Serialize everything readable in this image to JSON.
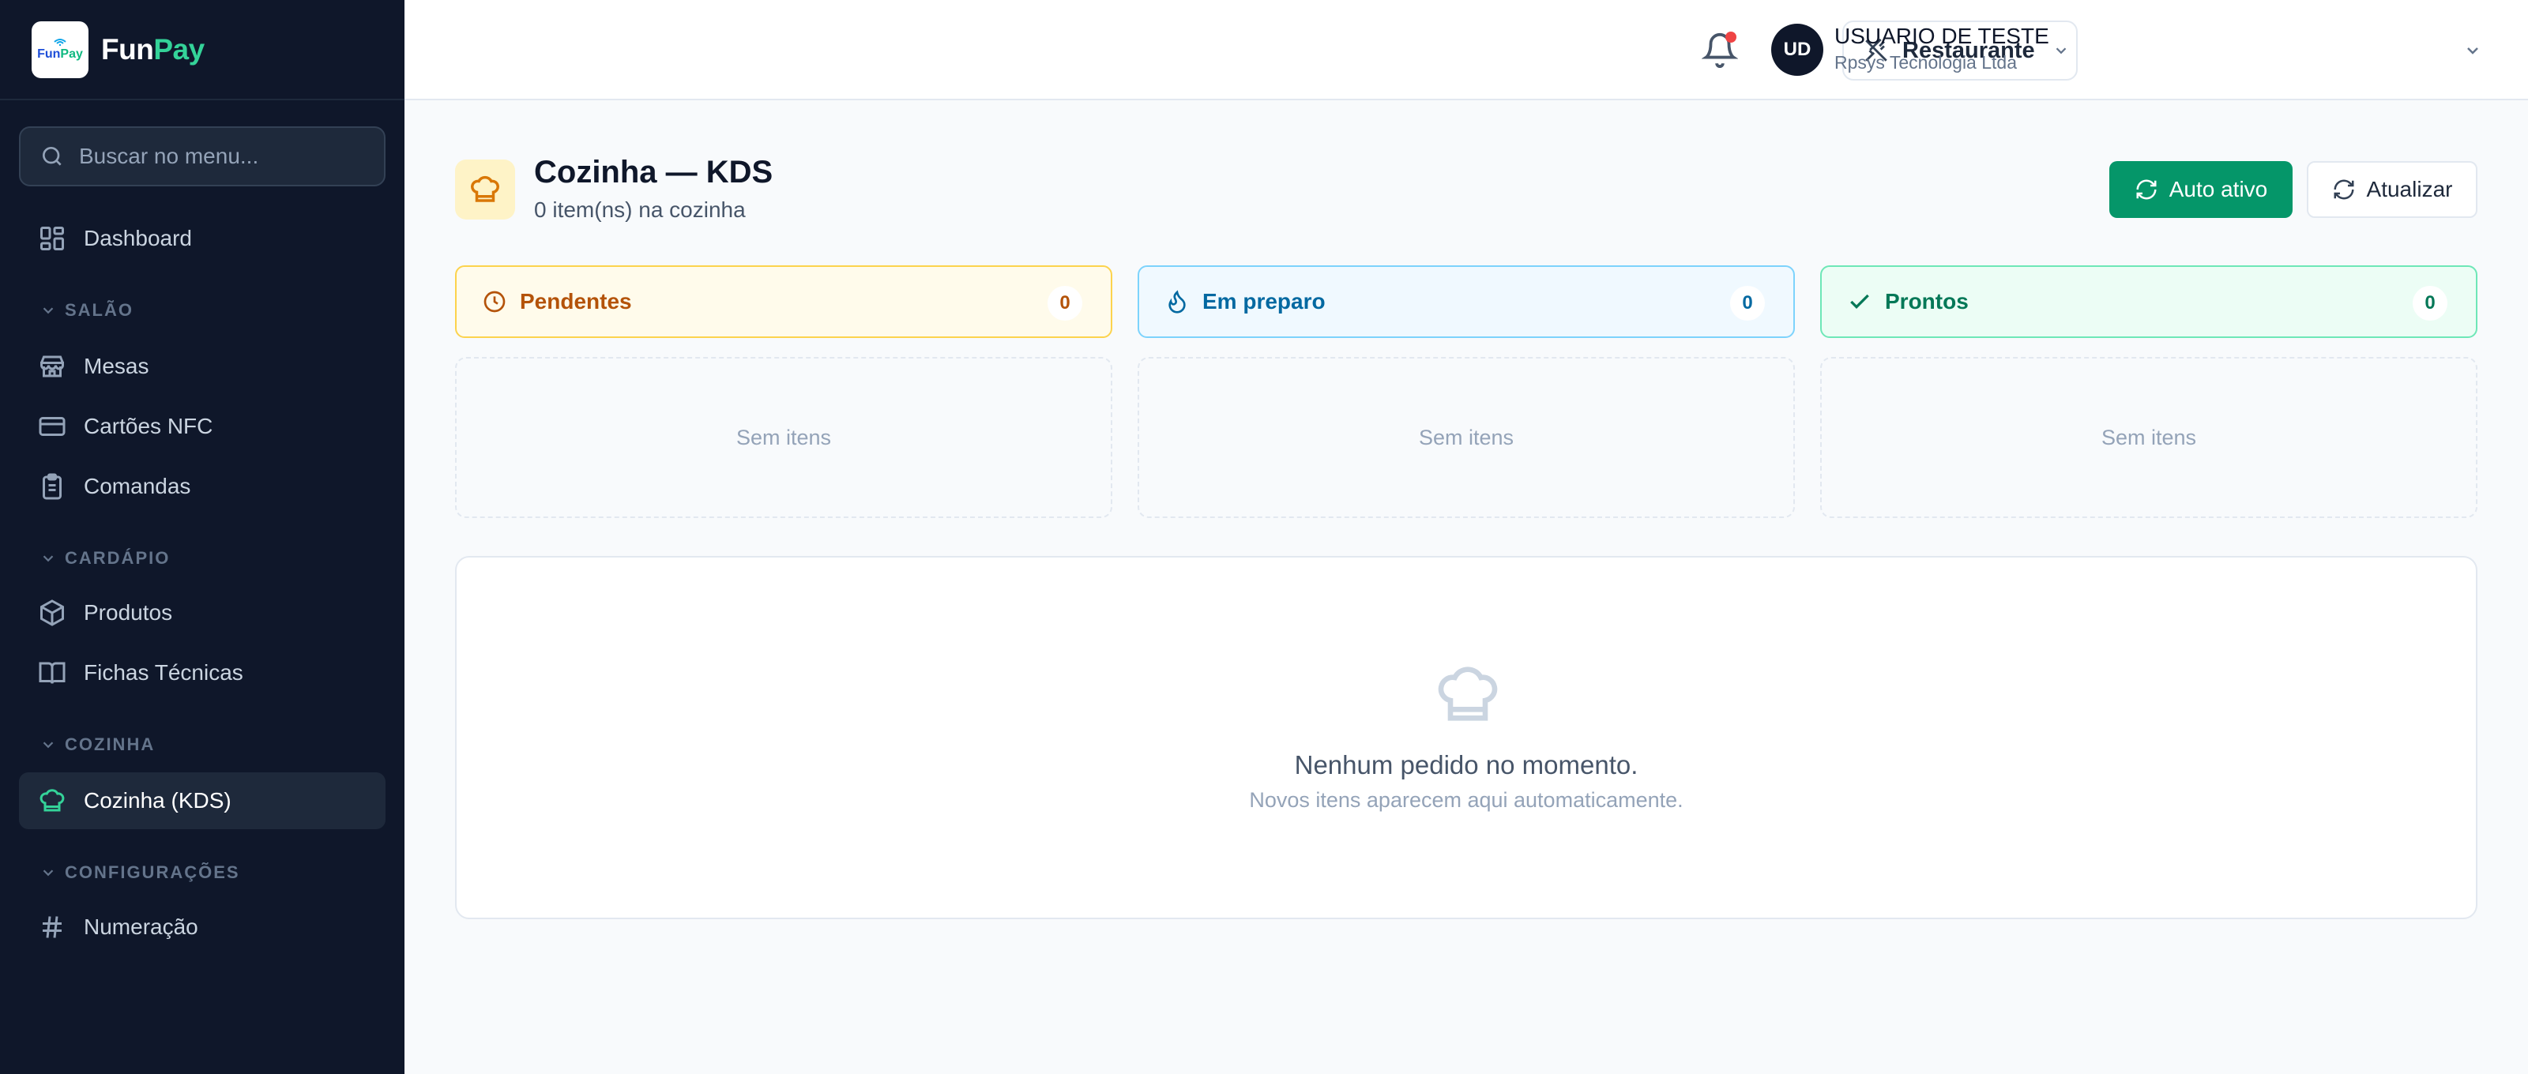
{
  "brand": {
    "logo_text_a": "Fun",
    "logo_text_b": "Pay",
    "name_a": "Fun",
    "name_b": "Pay"
  },
  "sidebar": {
    "search_placeholder": "Buscar no menu...",
    "dashboard": "Dashboard",
    "sections": {
      "salao": "SALÃO",
      "cardapio": "CARDÁPIO",
      "cozinha": "COZINHA",
      "config": "CONFIGURAÇÕES"
    },
    "items": {
      "mesas": "Mesas",
      "cartoes": "Cartões NFC",
      "comandas": "Comandas",
      "produtos": "Produtos",
      "fichas": "Fichas Técnicas",
      "kds": "Cozinha (KDS)",
      "numeracao": "Numeração"
    }
  },
  "header": {
    "store": "Restaurante",
    "user_initials": "UD",
    "user_name": "USUARIO DE TESTE",
    "user_company": "Rpsys Tecnologia Ltda"
  },
  "page": {
    "title": "Cozinha — KDS",
    "subtitle": "0 item(ns) na cozinha",
    "auto_label": "Auto ativo",
    "refresh_label": "Atualizar"
  },
  "columns": [
    {
      "label": "Pendentes",
      "count": "0",
      "empty": "Sem itens"
    },
    {
      "label": "Em preparo",
      "count": "0",
      "empty": "Sem itens"
    },
    {
      "label": "Prontos",
      "count": "0",
      "empty": "Sem itens"
    }
  ],
  "empty_state": {
    "title": "Nenhum pedido no momento.",
    "subtitle": "Novos itens aparecem aqui automaticamente."
  },
  "colors": {
    "sidebar_bg": "#0f172a",
    "accent_green": "#059669",
    "pending": "#b45309",
    "preparing": "#0369a1",
    "ready": "#047857"
  }
}
